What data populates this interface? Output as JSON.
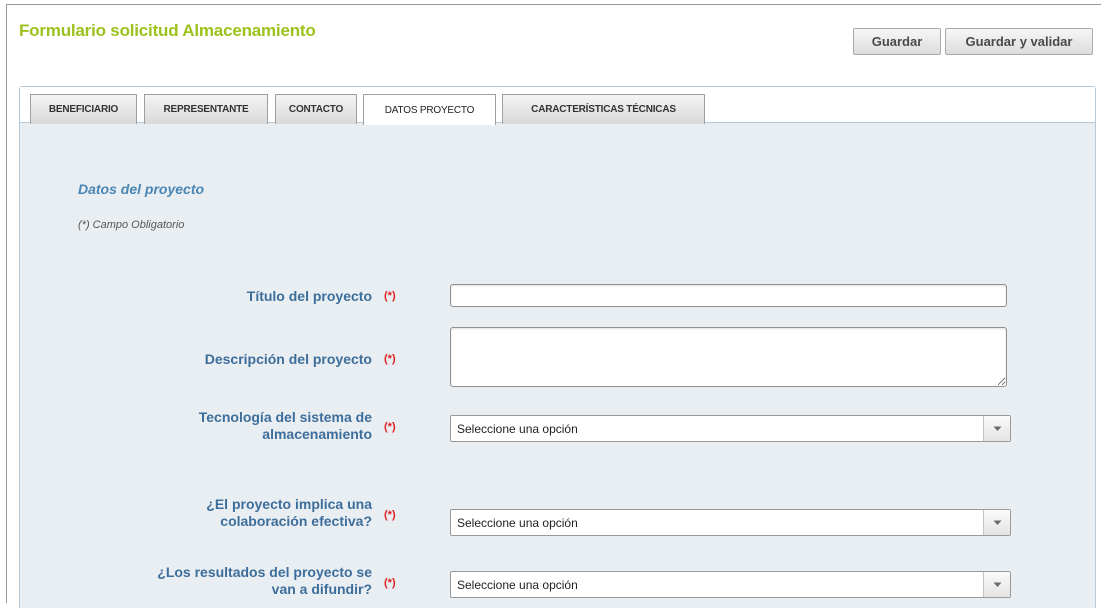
{
  "header": {
    "title": "Formulario solicitud Almacenamiento",
    "save_label": "Guardar",
    "save_validate_label": "Guardar y validar"
  },
  "tabs": [
    {
      "label": "BENEFICIARIO"
    },
    {
      "label": "REPRESENTANTE"
    },
    {
      "label": "CONTACTO"
    },
    {
      "label": "DATOS PROYECTO",
      "active": true
    },
    {
      "label": "CARACTERÍSTICAS TÉCNICAS"
    }
  ],
  "section": {
    "title": "Datos del proyecto",
    "mandatory_note": "(*) Campo Obligatorio"
  },
  "fields": {
    "titulo": {
      "label": "Título del proyecto",
      "required_mark": "(*)",
      "value": ""
    },
    "descripcion": {
      "label": "Descripción del proyecto",
      "required_mark": "(*)",
      "value": ""
    },
    "tecnologia": {
      "label_line1": "Tecnología del sistema de",
      "label_line2": "almacenamiento",
      "required_mark": "(*)",
      "value": "Seleccione una opción"
    },
    "colaboracion": {
      "label_line1": "¿El proyecto implica una",
      "label_line2": "colaboración efectiva?",
      "required_mark": "(*)",
      "value": "Seleccione una opción"
    },
    "difusion": {
      "label_line1": "¿Los resultados del proyecto se",
      "label_line2": "van a difundir?",
      "required_mark": "(*)",
      "value": "Seleccione una opción"
    }
  },
  "icons": {
    "dropdown": "chevron-down-icon",
    "resize": "resize-grip-icon"
  },
  "colors": {
    "title": "#9cc21b",
    "label": "#3d6e9b",
    "section_title": "#4a86b4",
    "required": "#e02020",
    "panel_bg": "#e9eef2"
  }
}
